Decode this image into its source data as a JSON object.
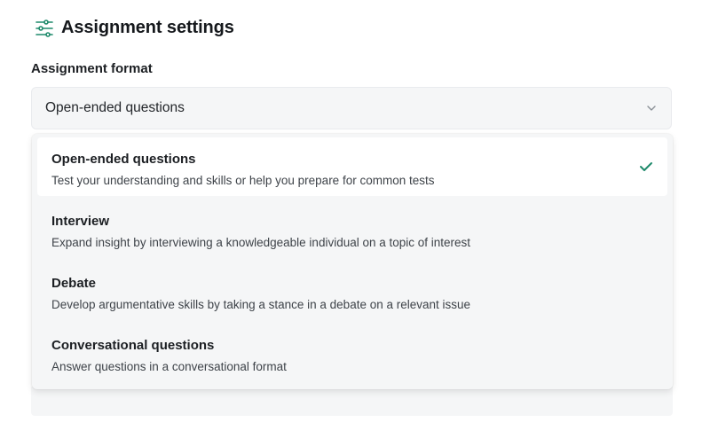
{
  "header": {
    "title": "Assignment settings",
    "icon": "sliders-icon"
  },
  "colors": {
    "accent": "#1f8a6b",
    "field_bg": "#f5f6f7"
  },
  "form": {
    "label": "Assignment format",
    "selected_value": "Open-ended questions",
    "options": [
      {
        "title": "Open-ended questions",
        "description": "Test your understanding and skills or help you prepare for common tests",
        "selected": true
      },
      {
        "title": "Interview",
        "description": "Expand insight by interviewing a knowledgeable individual on a topic of interest",
        "selected": false
      },
      {
        "title": "Debate",
        "description": "Develop argumentative skills by taking a stance in a debate on a relevant issue",
        "selected": false
      },
      {
        "title": "Conversational questions",
        "description": "Answer questions in a conversational format",
        "selected": false
      }
    ]
  }
}
